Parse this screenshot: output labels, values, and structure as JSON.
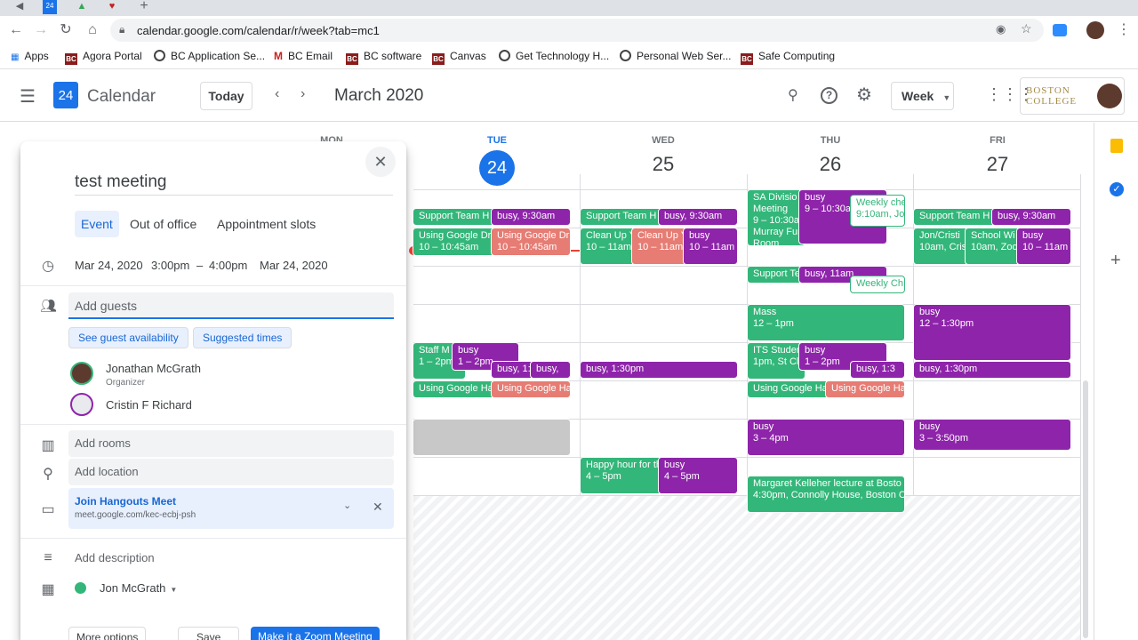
{
  "browser": {
    "url": "calendar.google.com/calendar/r/week?tab=mc1",
    "bookmarks": [
      "Apps",
      "Agora Portal",
      "BC Application Se...",
      "BC Email",
      "BC software",
      "Canvas",
      "Get Technology H...",
      "Personal Web Ser...",
      "Safe Computing"
    ]
  },
  "header": {
    "logo_num": "24",
    "app_title": "Calendar",
    "today_label": "Today",
    "month_label": "March 2020",
    "view_label": "Week",
    "org_logo_line1": "BOSTON",
    "org_logo_line2": "COLLEGE"
  },
  "days": [
    {
      "name": "MON",
      "num": ""
    },
    {
      "name": "TUE",
      "num": "24"
    },
    {
      "name": "WED",
      "num": "25"
    },
    {
      "name": "THU",
      "num": "26"
    },
    {
      "name": "FRI",
      "num": "27"
    }
  ],
  "events": {
    "tue_support": "Support Team H",
    "tue_busy930": "busy, 9:30am",
    "tue_drive1_title": "Using Google Dri",
    "tue_drive1_time": "10 – 10:45am",
    "tue_drive2_title": "Using Google Dri",
    "tue_drive2_time": "10 – 10:45am",
    "tue_staff_title": "Staff M",
    "tue_staff_time": "1 – 2pm",
    "tue_busy1_title": "busy",
    "tue_busy1_time": "1 – 2pm",
    "tue_busy_a": "busy, 1:",
    "tue_busy_b": "busy,",
    "tue_ha1": "Using Google Ha",
    "tue_ha2": "Using Google Ha",
    "wed_support": "Support Team H",
    "wed_busy930": "busy, 9:30am",
    "wed_clean1_title": "Clean Up Y",
    "wed_clean1_time": "10 – 11am",
    "wed_clean2_title": "Clean Up Y",
    "wed_clean2_time": "10 – 11am",
    "wed_busy10_title": "busy",
    "wed_busy10_time": "10 – 11am",
    "wed_busy130": "busy, 1:30pm",
    "wed_happy_title": "Happy hour for th",
    "wed_happy_time": "4 – 5pm",
    "wed_busy4_title": "busy",
    "wed_busy4_time": "4 – 5pm",
    "thu_sa_title": "SA Divisio",
    "thu_sa_line2": "Meeting",
    "thu_sa_time": "9 – 10:30a",
    "thu_sa_loc": "Murray Fun",
    "thu_sa_loc2": "Room",
    "thu_busy9_title": "busy",
    "thu_busy9_time": "9 – 10:30a",
    "thu_weekly_title": "Weekly che",
    "thu_weekly_time": "9:10am, Jo",
    "thu_support": "Support Te",
    "thu_busy11": "busy, 11am",
    "thu_weekly2": "Weekly Ch",
    "thu_mass_title": "Mass",
    "thu_mass_time": "12 – 1pm",
    "thu_its_title": "ITS Studen",
    "thu_its_time": "1pm, St Cl",
    "thu_busy1_title": "busy",
    "thu_busy1_time": "1 – 2pm",
    "thu_busy13": "busy, 1:3",
    "thu_ha1": "Using Google Ha",
    "thu_ha2": "Using Google Ha",
    "thu_busy3_title": "busy",
    "thu_busy3_time": "3 – 4pm",
    "thu_mk_title": "Margaret Kelleher lecture at Bosto",
    "thu_mk_time": "4:30pm, Connolly House, Boston Co",
    "fri_support": "Support Team H",
    "fri_busy930": "busy, 9:30am",
    "fri_jon_title": "Jon/Cristi",
    "fri_jon_time": "10am, Cris",
    "fri_school_title": "School Wi",
    "fri_school_time": "10am, Zoo",
    "fri_busy10_title": "busy",
    "fri_busy10_time": "10 – 11am",
    "fri_busy12_title": "busy",
    "fri_busy12_time": "12 – 1:30pm",
    "fri_busy130": "busy, 1:30pm",
    "fri_busy3_title": "busy",
    "fri_busy3_time": "3 – 3:50pm"
  },
  "popup": {
    "title": "test meeting",
    "tabs": [
      "Event",
      "Out of office",
      "Appointment slots"
    ],
    "start_date": "Mar 24, 2020",
    "start_time": "3:00pm",
    "dash": "–",
    "end_time": "4:00pm",
    "end_date": "Mar 24, 2020",
    "guests_placeholder": "Add guests",
    "guest_availability": "See guest availability",
    "suggested_times": "Suggested times",
    "guests": [
      {
        "name": "Jonathan McGrath",
        "role": "Organizer"
      },
      {
        "name": "Cristin F Richard",
        "role": ""
      }
    ],
    "add_rooms": "Add rooms",
    "add_location": "Add location",
    "hangouts_title": "Join Hangouts Meet",
    "hangouts_link": "meet.google.com/kec-ecbj-psh",
    "add_description": "Add description",
    "calendar_owner": "Jon McGrath",
    "more_options": "More options",
    "save": "Save",
    "zoom": "Make it a Zoom Meeting"
  },
  "colors": {
    "green": "#33b679",
    "purple": "#8e24aa",
    "red": "#e67c73",
    "accent": "#1a73e8"
  }
}
